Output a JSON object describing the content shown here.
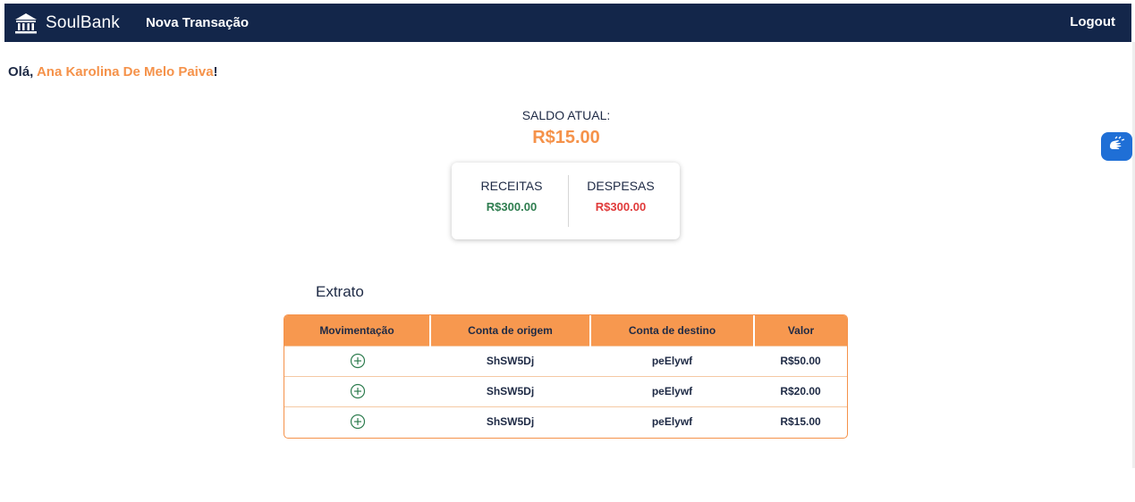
{
  "navbar": {
    "brand": "SoulBank",
    "new_transaction": "Nova Transação",
    "logout": "Logout"
  },
  "greeting": {
    "prefix": "Olá, ",
    "user_name": "Ana Karolina De Melo Paiva",
    "suffix": "!"
  },
  "balance": {
    "label": "SALDO ATUAL:",
    "value": "R$15.00"
  },
  "summary": {
    "income_label": "RECEITAS",
    "income_value": "R$300.00",
    "expense_label": "DESPESAS",
    "expense_value": "R$300.00"
  },
  "statement": {
    "title": "Extrato",
    "columns": [
      "Movimentação",
      "Conta de origem",
      "Conta de destino",
      "Valor"
    ],
    "rows": [
      {
        "type_icon": "plus-circle-icon",
        "origin": "ShSW5Dj",
        "destination": "peElywf",
        "amount": "R$50.00"
      },
      {
        "type_icon": "plus-circle-icon",
        "origin": "ShSW5Dj",
        "destination": "peElywf",
        "amount": "R$20.00"
      },
      {
        "type_icon": "plus-circle-icon",
        "origin": "ShSW5Dj",
        "destination": "peElywf",
        "amount": "R$15.00"
      }
    ]
  },
  "colors": {
    "navbar": "#13264a",
    "accent": "#f5924a",
    "income": "#2e7d4f",
    "expense": "#e03a3a",
    "accessibility": "#1f6fd6"
  },
  "icons": {
    "brand": "bank-icon",
    "accessibility": "sign-language-icon"
  }
}
